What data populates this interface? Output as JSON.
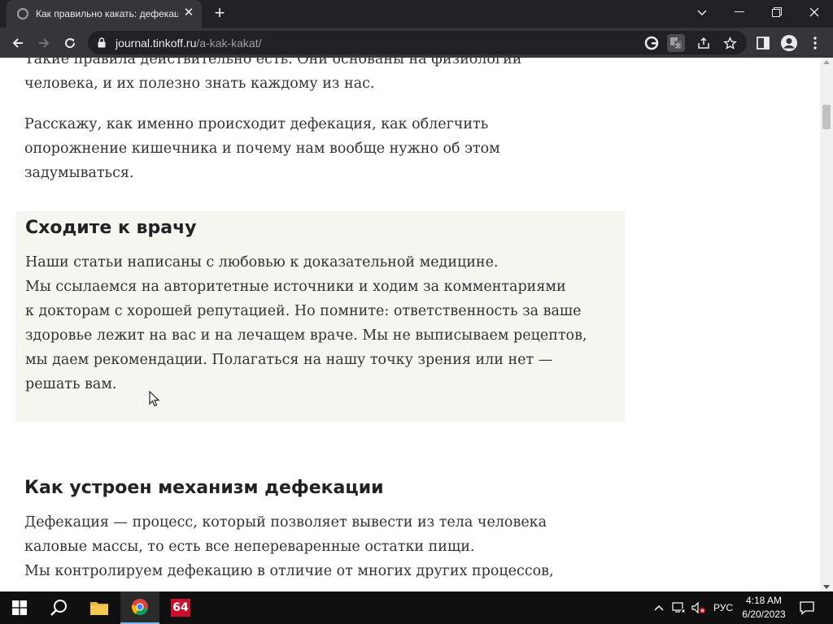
{
  "browser": {
    "tab_title": "Как правильно какать: дефекация",
    "tab_close": "✕",
    "new_tab": "+",
    "url_domain": "journal.tinkoff.ru",
    "url_path": "/a-kak-kakat/"
  },
  "article": {
    "intro_lines": [
      "Такие правила действительно есть. Они основаны на физиологии",
      "человека, и их полезно знать каждому из нас."
    ],
    "para2_lines": [
      "Расскажу, как именно происходит дефекация, как облегчить",
      "опорожнение кишечника и почему нам вообще нужно об этом",
      "задумываться."
    ],
    "callout": {
      "title": "Сходите к врачу",
      "lines": [
        "Наши статьи написаны с любовью к доказательной медицине.",
        "Мы ссылаемся на авторитетные источники и ходим за комментариями",
        "к докторам с хорошей репутацией. Но помните: ответственность за ваше",
        "здоровье лежит на вас и на лечащем враче. Мы не выписываем рецептов,",
        "мы даем рекомендации. Полагаться на нашу точку зрения или нет —",
        "решать вам."
      ]
    },
    "section_heading": "Как устроен механизм дефекации",
    "section_lines": [
      "Дефекация — процесс, который позволяет вывести из тела человека",
      "каловые массы, то есть все непереваренные остатки пищи.",
      "Мы контролируем дефекацию в отличие от многих других процессов,"
    ]
  },
  "taskbar": {
    "app_badge": "64",
    "language": "РУС",
    "time": "4:18 AM",
    "date": "6/20/2023"
  },
  "colors": {
    "chrome_dark": "#202124",
    "chrome_toolbar": "#35363a",
    "callout_bg": "#f6f5f0",
    "taskbar_bg": "#101010",
    "app_badge_bg": "#c8102e"
  }
}
